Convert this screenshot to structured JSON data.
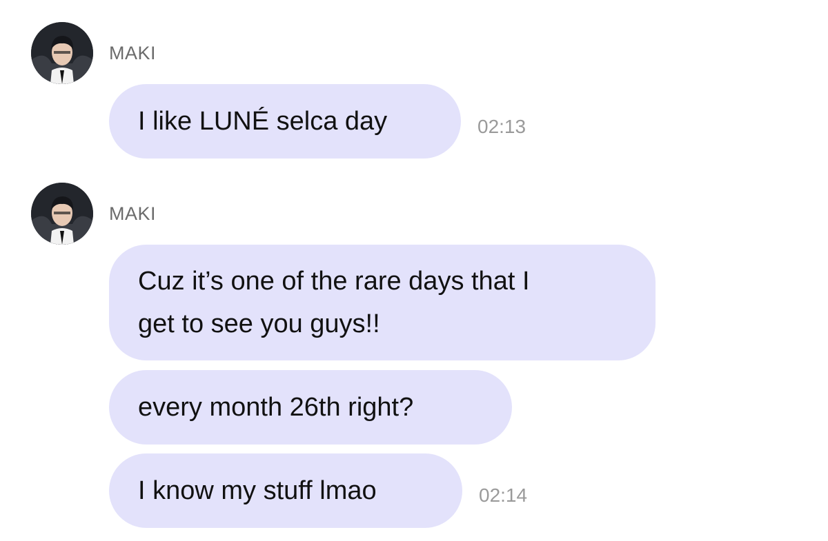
{
  "messages": [
    {
      "sender": "MAKI",
      "avatar_icon": "profile-photo-avatar",
      "bubbles": [
        {
          "text": "I like LUNÉ selca day",
          "time": "02:13"
        }
      ]
    },
    {
      "sender": "MAKI",
      "avatar_icon": "profile-photo-avatar",
      "bubbles": [
        {
          "text": "Cuz it’s one of the rare days that I\nget to see you guys!!",
          "time": ""
        },
        {
          "text": "every month 26th right?",
          "time": ""
        },
        {
          "text": "I know my stuff lmao",
          "time": "02:14"
        }
      ]
    }
  ],
  "colors": {
    "bubble": "#e3e2fb",
    "sender": "#6b6b6b",
    "timestamp": "#9a9a9a",
    "text": "#111111"
  }
}
